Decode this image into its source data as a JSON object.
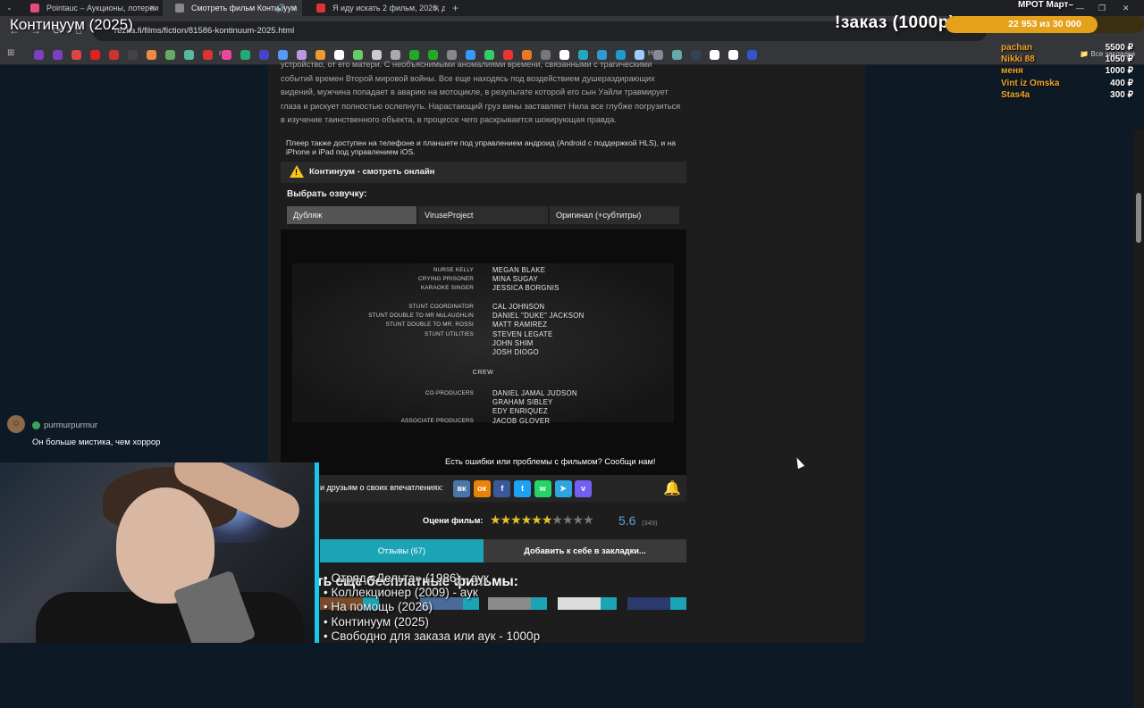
{
  "browser": {
    "tabs": [
      {
        "title": "Pointauc – Аукционы, лотереи",
        "favicon_color": "#e44d7b",
        "active": false
      },
      {
        "title": "Смотреть фильм Континуум",
        "favicon_color": "#888888",
        "active": true
      },
      {
        "title": "Я иду искать 2 фильм, 2026, д",
        "favicon_color": "#d33",
        "active": false
      }
    ],
    "url": "rezka.fi/films/fiction/81586-kontinuum-2025.html",
    "bookmark_labels": [
      "b",
      "m",
      "H"
    ],
    "bookmark_folder": "Все закладки"
  },
  "stream": {
    "title": "Континуум (2025)",
    "order_label": "!заказ (1000р)",
    "goal_title": "МРОТ Март–",
    "goal_progress": "22 953  из 30 000",
    "goal_fraction": 0.765,
    "donors": [
      {
        "name": "pachan",
        "amount": "5500 ₽"
      },
      {
        "name": "Nikki 88",
        "amount": "1050 ₽"
      },
      {
        "name": "меня",
        "amount": "1000 ₽"
      },
      {
        "name": "Vint iz Omska",
        "amount": "400 ₽"
      },
      {
        "name": "Stas4a",
        "amount": "300 ₽"
      }
    ],
    "chat": {
      "user": "purmurpurmur",
      "message": "Он больше мистика, чем хоррор"
    },
    "ticker": [
      "• Отряд «Дельта» (1986) - аук",
      "• Коллекционер (2009) - аук",
      "• На помощь (2026)",
      "• Континуум (2025)",
      "• Свободно для заказа или аук - 1000р"
    ]
  },
  "page": {
    "description": "устройство, от его матери. С необъяснимыми аномалиями времени, связанными с трагическими событий времен Второй мировой войны. Все еще находясь под воздействием душераздирающих видений, мужчина попадает в аварию на мотоцикле, в результате которой его сын Уайли травмирует глаза и рискует полностью ослепнуть. Нарастающий груз вины заставляет Нила все глубже погрузиться в изучение таинственного объекта, в процессе чего раскрывается шокирующая правда.",
    "player_note": "Плеер также доступен на телефоне и планшете под управлением андроид (Android с поддержкой HLS), и на iPhone и iPad под управлением iOS.",
    "player_title": "Континуум - смотреть онлайн",
    "voice_label": "Выбрать озвучку:",
    "voices": [
      "Дубляж",
      "ViruseProject",
      "Оригинал (+субтитры)"
    ],
    "report": "Есть ошибки или проблемы с фильмом? Сообщи нам!",
    "share_text": "и друзьям о своих впечатлениях:",
    "share_buttons": [
      {
        "icon": "vk-icon",
        "glyph": "вк",
        "color": "#4a76a8"
      },
      {
        "icon": "ok-icon",
        "glyph": "ок",
        "color": "#ee8208"
      },
      {
        "icon": "facebook-icon",
        "glyph": "f",
        "color": "#3b5998"
      },
      {
        "icon": "twitter-icon",
        "glyph": "t",
        "color": "#1da1f2"
      },
      {
        "icon": "whatsapp-icon",
        "glyph": "w",
        "color": "#25d366"
      },
      {
        "icon": "telegram-icon",
        "glyph": "➤",
        "color": "#2ca5e0"
      },
      {
        "icon": "viber-icon",
        "glyph": "v",
        "color": "#7360f2"
      }
    ],
    "rate_label": "Оцени фильм:",
    "rating": "5.6",
    "rating_count": "(349)",
    "rating_stars": 5.6,
    "reviews_tab": "Отзывы (67)",
    "bookmark_tab": "Добавить к себе в закладки...",
    "more_title": "ть еще бесплатные фильмы:"
  },
  "credits": {
    "rows": [
      {
        "role": "NURSE KELLY",
        "name": "MEGAN BLAKE"
      },
      {
        "role": "CRYING PRISONER",
        "name": "MINA SUGAY"
      },
      {
        "role": "KARAOKE SINGER",
        "name": "JESSICA BORGNIS"
      },
      {
        "role": "STUNT COORDINATOR",
        "name": "CAL JOHNSON"
      },
      {
        "role": "STUNT DOUBLE TO MR McLAUGHLIN",
        "name": "DANIEL \"DUKE\" JACKSON"
      },
      {
        "role": "STUNT DOUBLE TO MR. ROSSI",
        "name": "MATT RAMIREZ"
      },
      {
        "role": "STUNT UTILITIES",
        "name": "STEVEN LEGATE"
      },
      {
        "role": "",
        "name": "JOHN SHIM"
      },
      {
        "role": "",
        "name": "JOSH DIOGO"
      },
      {
        "role": "CO-PRODUCERS",
        "name": "DANIEL JAMAL JUDSON"
      },
      {
        "role": "",
        "name": "GRAHAM SIBLEY"
      },
      {
        "role": "",
        "name": "EDY ENRIQUEZ"
      },
      {
        "role": "ASSOCIATE PRODUCERS",
        "name": "JACOB GLOVER"
      }
    ],
    "section": "CREW"
  }
}
